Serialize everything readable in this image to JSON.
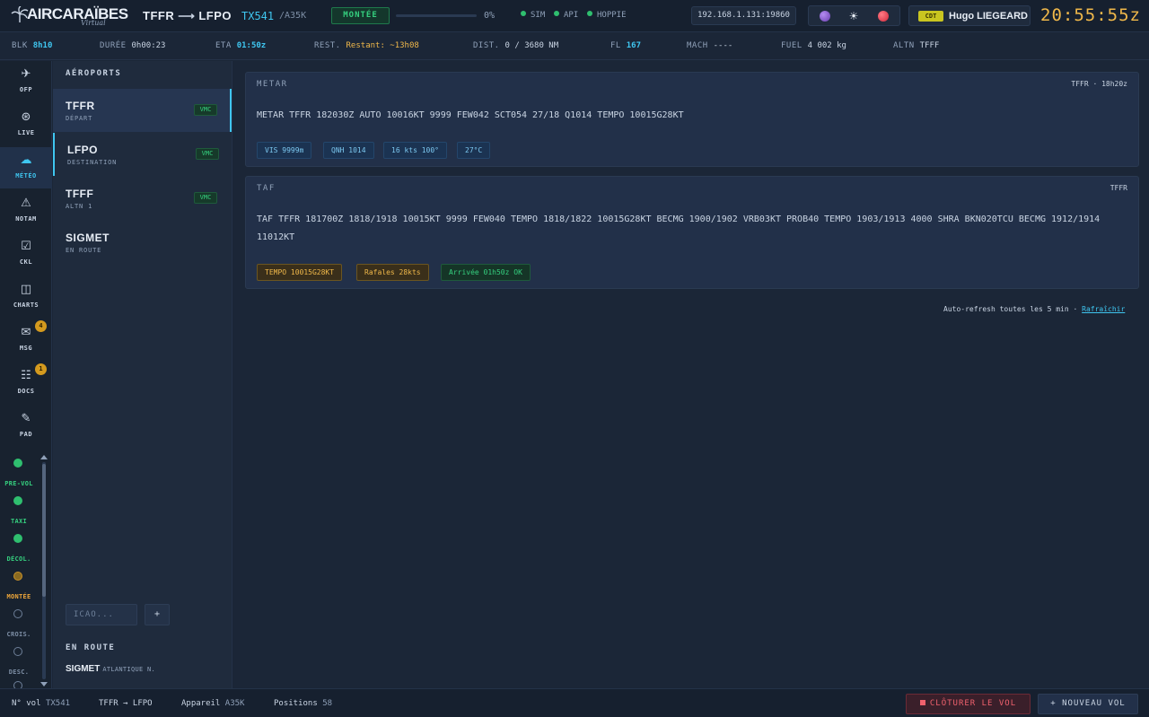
{
  "header": {
    "brand": "AIRCARAÏBES",
    "brand_tag": "Virtual",
    "route_from": "TFFR",
    "route_arrow": "⟶",
    "route_to": "LFPO",
    "callsign": "TX541",
    "aircraft": "/A35K",
    "phase": "MONTÉE",
    "progress_percent": 0,
    "progress_label": "0%",
    "connections": [
      {
        "label": "SIM",
        "status": "connected"
      },
      {
        "label": "API",
        "status": "connected"
      },
      {
        "label": "HOPPIE",
        "status": "connected"
      }
    ],
    "ip": "192.168.1.131:19860",
    "user_role": "CDT",
    "user_name": "Hugo LIEGEARD",
    "clock": "20:55:55z"
  },
  "infobar": {
    "blk_label": "BLK",
    "blk_value": "8h10",
    "duree_label": "DURÉE",
    "duree_value": "0h00:23",
    "eta_label": "ETA",
    "eta_value": "01:50z",
    "rest_label": "REST.",
    "rest_value": "Restant: ~13h08",
    "dist_label": "DIST.",
    "dist_value": "0 / 3680 NM",
    "fl_label": "FL",
    "fl_value": "167",
    "mach_label": "MACH",
    "mach_value": "----",
    "fuel_label": "FUEL",
    "fuel_value": "4 002 kg",
    "altn_label": "ALTN",
    "altn_value": "TFFF"
  },
  "nav": {
    "items": [
      {
        "label": "OFP",
        "icon": "airplane-icon"
      },
      {
        "label": "LIVE",
        "icon": "live-icon"
      },
      {
        "label": "MÉTÉO",
        "icon": "cloud-icon"
      },
      {
        "label": "NOTAM",
        "icon": "warning-icon"
      },
      {
        "label": "CKL",
        "icon": "checklist-icon"
      },
      {
        "label": "CHARTS",
        "icon": "charts-icon"
      },
      {
        "label": "MSG",
        "icon": "mail-icon",
        "badge": "4"
      },
      {
        "label": "DOCS",
        "icon": "docs-icon",
        "badge": "1"
      },
      {
        "label": "PAD",
        "icon": "pencil-icon"
      }
    ],
    "phases": [
      {
        "label": "PRE-VOL",
        "state": "done"
      },
      {
        "label": "TAXI",
        "state": "done"
      },
      {
        "label": "DÉCOL.",
        "state": "done"
      },
      {
        "label": "MONTÉE",
        "state": "current"
      },
      {
        "label": "CROIS.",
        "state": "todo"
      },
      {
        "label": "DESC.",
        "state": "todo"
      }
    ]
  },
  "airports": {
    "title": "AÉROPORTS",
    "items": [
      {
        "code": "TFFR",
        "role": "DÉPART",
        "cond": "VMC"
      },
      {
        "code": "LFPO",
        "role": "DESTINATION",
        "cond": "VMC"
      },
      {
        "code": "TFFF",
        "role": "ALTN 1",
        "cond": "VMC"
      },
      {
        "code": "SIGMET",
        "role": "EN ROUTE",
        "cond": ""
      }
    ],
    "icao_placeholder": "ICAO...",
    "add_label": "+",
    "enroute_title": "EN ROUTE",
    "enroute_sigmet": "SIGMET",
    "enroute_region": "ATLANTIQUE N."
  },
  "metar": {
    "title": "METAR",
    "meta": "TFFR · 18h20z",
    "raw": "METAR TFFR 182030Z AUTO 10016KT 9999 FEW042 SCT054 27/18 Q1014 TEMPO 10015G28KT",
    "chips": [
      "VIS 9999m",
      "QNH 1014",
      "16 kts 100°",
      "27°C"
    ]
  },
  "taf": {
    "title": "TAF",
    "meta": "TFFR",
    "raw": "TAF TFFR 181700Z 1818/1918 10015KT 9999 FEW040 TEMPO 1818/1822 10015G28KT BECMG 1900/1902 VRB03KT PROB40 TEMPO 1903/1913 4000 SHRA BKN020TCU BECMG 1912/1914 11012KT",
    "chips": [
      "TEMPO 10015G28KT",
      "Rafales 28kts",
      "Arrivée 01h50z OK"
    ]
  },
  "refresh": {
    "text": "Auto-refresh toutes les 5 min ·",
    "link": "Rafraîchir"
  },
  "footer": {
    "flight_label": "N° vol",
    "flight_value": "TX541",
    "route": "TFFR → LFPO",
    "aircraft_label": "Appareil",
    "aircraft_value": "A35K",
    "positions_label": "Positions",
    "positions_value": "58",
    "close_label": "CLÔTURER LE VOL",
    "new_label": "+ NOUVEAU VOL"
  },
  "colors": {
    "accent": "#3fc6f0",
    "ok": "#35d07f",
    "warn": "#f0b84a",
    "danger": "#f0616d",
    "background": "#1b2637"
  }
}
